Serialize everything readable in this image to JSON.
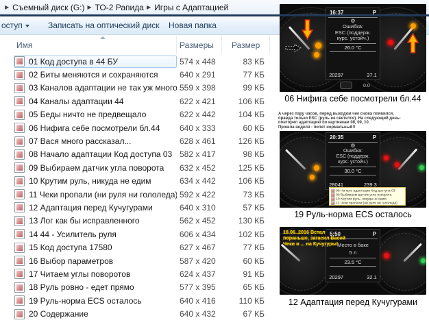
{
  "breadcrumb": {
    "items": [
      "Съемный диск (G:)",
      "ТО-2 Рапида",
      "Игры с Адаптацией"
    ]
  },
  "toolbar": {
    "share": "оступ",
    "burn": "Записать на оптический диск",
    "new_folder": "Новая папка"
  },
  "file_list": {
    "columns": {
      "name": "Имя",
      "dimensions": "Размеры",
      "size": "Размер"
    },
    "rows": [
      {
        "name": "01 Код доступа в 44 БУ",
        "dimensions": "574 x 448",
        "size": "83 КБ",
        "selected": true
      },
      {
        "name": "02 Биты меняются и сохраняются",
        "dimensions": "640 x 291",
        "size": "77 КБ"
      },
      {
        "name": "03 Каналов адаптации не так уж много",
        "dimensions": "559 x 398",
        "size": "99 КБ"
      },
      {
        "name": "04 Каналы адаптации 44",
        "dimensions": "622 x 421",
        "size": "106 КБ"
      },
      {
        "name": "05 Беды ничто не предвещало",
        "dimensions": "622 x 442",
        "size": "104 КБ"
      },
      {
        "name": "06 Нифига себе посмотрели бл.44",
        "dimensions": "640 x 333",
        "size": "60 КБ"
      },
      {
        "name": "07 Вася много рассказал...",
        "dimensions": "628 x 461",
        "size": "126 КБ"
      },
      {
        "name": "08 Начало адаптации Код доступа 03",
        "dimensions": "582 x 417",
        "size": "98 КБ"
      },
      {
        "name": "09 Выбираем датчик угла поворота",
        "dimensions": "632 x 452",
        "size": "125 КБ"
      },
      {
        "name": "10 Крутим руль, никуда не едим",
        "dimensions": "634 x 442",
        "size": "106 КБ"
      },
      {
        "name": "11 Чеки пропали (ни руля ни гололеда)",
        "dimensions": "592 x 422",
        "size": "73 КБ"
      },
      {
        "name": "12 Адаптация перед Кучугурами",
        "dimensions": "640 x 310",
        "size": "57 КБ"
      },
      {
        "name": "13 Лог как бы исправленного",
        "dimensions": "562 x 452",
        "size": "130 КБ"
      },
      {
        "name": "14 44 - Усилитель руля",
        "dimensions": "606 x 434",
        "size": "102 КБ"
      },
      {
        "name": "15 Код доступа 17580",
        "dimensions": "627 x 467",
        "size": "77 КБ"
      },
      {
        "name": "16 Выбор параметров",
        "dimensions": "587 x 420",
        "size": "60 КБ"
      },
      {
        "name": "17 Читаем углы поворотов",
        "dimensions": "624 x 437",
        "size": "91 КБ"
      },
      {
        "name": "18 Руль ровно - едет прямо",
        "dimensions": "577 x 395",
        "size": "65 КБ"
      },
      {
        "name": "19 Руль-норма ECS осталось",
        "dimensions": "640 x 416",
        "size": "110 КБ"
      },
      {
        "name": "20 Содержание",
        "dimensions": "640 x 432",
        "size": "67 КБ"
      }
    ]
  },
  "panels": {
    "p1": {
      "caption": "06 Нифига себе посмотрели бл.44",
      "display": {
        "time": "16:37",
        "prndl": "P",
        "gear_icon": "⚙",
        "lines": [
          "Ошибка:",
          "ESC (поддерж.",
          "курс. устойч.)"
        ],
        "temp": "26.0 °C",
        "odo": "20297",
        "trip": "37.1"
      },
      "extra": "0.0"
    },
    "note": {
      "lines": [
        "А через пару часов, перед выходом чек снова появился,",
        "правда только ESC (руль не светится). На следующий день-",
        "повторил адаптацию по картинкам 08, 09, 10.",
        "Прошла неделя - полет нормальный!!"
      ]
    },
    "p2": {
      "caption": "19 Руль-норма ECS осталось",
      "display": {
        "time": "20:35",
        "prndl": "P",
        "gear_icon": "⚙",
        "lines": [
          "Ошибка:",
          "ESC (поддерж.",
          "курс. устойч.)"
        ],
        "temp": "30.0 °C",
        "odo": "28041",
        "trip": "239.3"
      },
      "tooltip": [
        "08 Начало адаптации Код доступа 03",
        "09 Выбираем датчик угла поворота",
        "10 Крутим руль, никуда не едим",
        "11 Чеки пропали (ни руля ни гололеда)"
      ]
    },
    "p3": {
      "caption": "12 Адаптация перед Кучугурами",
      "note": [
        "18.06..2016 Встал",
        "пораньше, загасил Васей",
        "Чеки и ... на Кучугуры!"
      ],
      "display": {
        "time": "5:50",
        "prndl": "P",
        "lines": [
          "Место в баке",
          "5 л"
        ],
        "temp": "23.5 °C",
        "odo": "20297",
        "trip": "32.1"
      }
    }
  },
  "colors": {
    "selection_border": "#a9c9e8",
    "toolbar_text": "#1e3c5c",
    "navy_band": "#17293f",
    "warning_orange": "#ff9d00",
    "warning_red": "#e81010",
    "ok_green": "#2fd050",
    "tooltip_bg": "#ffffe1",
    "yellow_note": "#ffd800"
  }
}
